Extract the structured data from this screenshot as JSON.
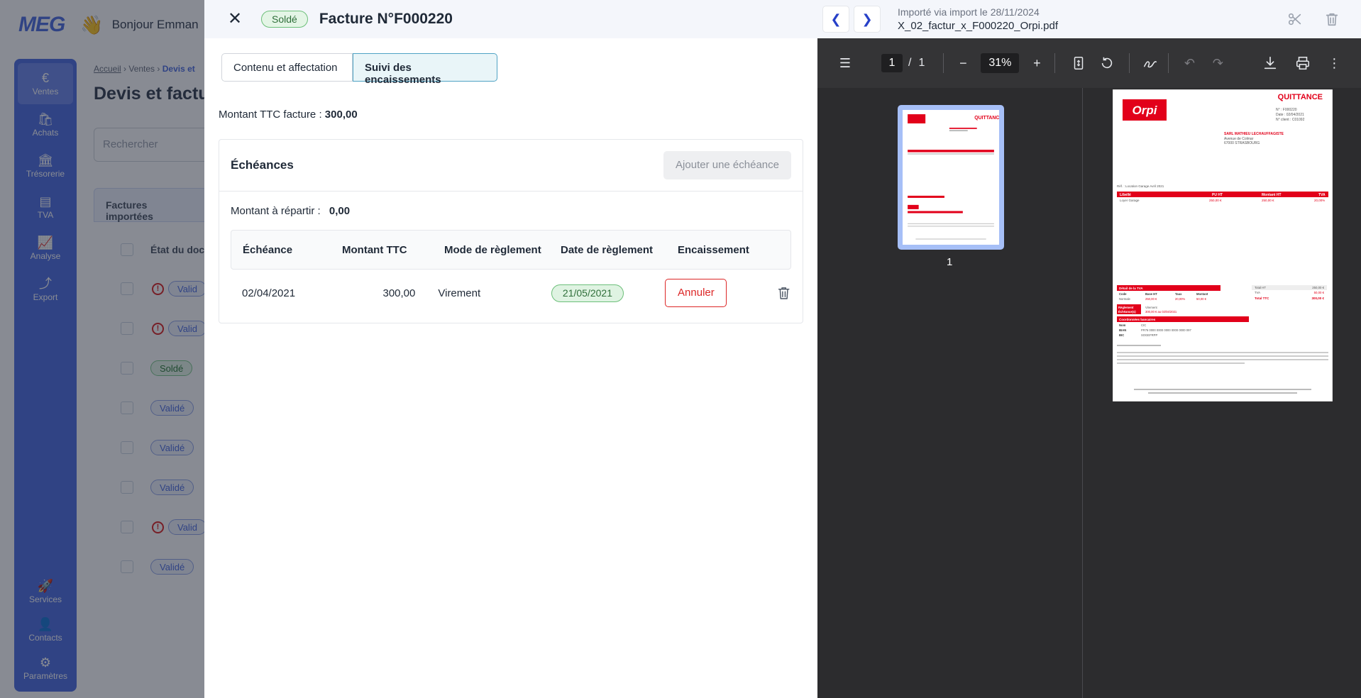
{
  "app": {
    "logo": "MEG",
    "greeting": "Bonjour Emman",
    "sidebar": [
      {
        "label": "Ventes",
        "icon": "€"
      },
      {
        "label": "Achats",
        "icon": "🛍"
      },
      {
        "label": "Trésorerie",
        "icon": "🏛"
      },
      {
        "label": "TVA",
        "icon": "▤"
      },
      {
        "label": "Analyse",
        "icon": "📈"
      },
      {
        "label": "Export",
        "icon": "⤴"
      }
    ],
    "sidebar_bottom": [
      {
        "label": "Services",
        "icon": "🚀"
      },
      {
        "label": "Contacts",
        "icon": "👤"
      },
      {
        "label": "Paramètres",
        "icon": "⚙"
      }
    ],
    "breadcrumb": [
      "Accueil",
      "Ventes",
      "Devis et"
    ],
    "page_title": "Devis et factu",
    "search_placeholder": "Rechercher",
    "tab_label": "Factures importées",
    "col_head": "État du doc",
    "rows": [
      {
        "status": "Valid",
        "warn": true
      },
      {
        "status": "Valid",
        "warn": true
      },
      {
        "status": "Soldé",
        "warn": false,
        "green": true
      },
      {
        "status": "Validé",
        "warn": false
      },
      {
        "status": "Validé",
        "warn": false
      },
      {
        "status": "Validé",
        "warn": false
      },
      {
        "status": "Valid",
        "warn": true
      },
      {
        "status": "Validé",
        "warn": false
      }
    ]
  },
  "drawer": {
    "status": "Soldé",
    "title": "Facture N°F000220",
    "tabs": [
      "Contenu et affectation",
      "Suivi des encaissements"
    ],
    "total_label": "Montant TTC facture :",
    "total_value": "300,00",
    "card_title": "Échéances",
    "add_button": "Ajouter une échéance",
    "remain_label": "Montant à répartir :",
    "remain_value": "0,00",
    "columns": [
      "Échéance",
      "Montant TTC",
      "Mode de règlement",
      "Date de règlement",
      "Encaissement"
    ],
    "rows": [
      {
        "echeance": "02/04/2021",
        "montant": "300,00",
        "mode": "Virement",
        "date": "21/05/2021",
        "action": "Annuler"
      }
    ]
  },
  "pdf": {
    "import_info": "Importé via import le 28/11/2024",
    "file_name": "X_02_factur_x_F000220_Orpi.pdf",
    "page_current": "1",
    "page_sep": "/",
    "page_total": "1",
    "zoom": "31%",
    "thumb_label": "1",
    "doc": {
      "heading": "QUITTANCE",
      "brand": "Orpi",
      "ref_lines": [
        "N° : F000220",
        "Date : 02/04/2021",
        "N° client : C01092"
      ],
      "client_name": "SARL MATHIEU LECHAUFFAGISTE",
      "client_lines": [
        "Avenue de Colmar",
        "67000 STRASBOURG"
      ],
      "object": "Réf. : Location Garage Avril 2021",
      "table_head": [
        "Libellé",
        "PU HT",
        "Montant HT",
        "TVA"
      ],
      "table_row": [
        "Loyer Garage",
        "250,00 €",
        "250,00 €",
        "20,00%"
      ],
      "vat_title": "Détail de la TVA",
      "vat_head": [
        "Code",
        "Base HT",
        "Taux",
        "Montant"
      ],
      "vat_row": [
        "Normale",
        "250,00 €",
        "20,00%",
        "50,00 €"
      ],
      "totals": [
        [
          "Total HT",
          "250,00 €"
        ],
        [
          "TVA",
          "50,00 €"
        ],
        [
          "Total TTC",
          "300,00 €"
        ]
      ],
      "payment_labels": [
        "Règlement",
        "Échéance(s)"
      ],
      "payment_values": [
        "Virement",
        "300,00 € au 02/04/2021"
      ],
      "bank_title": "Coordonnées bancaires",
      "bank_labels": [
        "Nom",
        "IBAN",
        "BIC"
      ],
      "bank_values": [
        "CIC",
        "FR76 0000 0000 0000 0000 0000 097",
        "SOGEFRPP"
      ]
    }
  }
}
